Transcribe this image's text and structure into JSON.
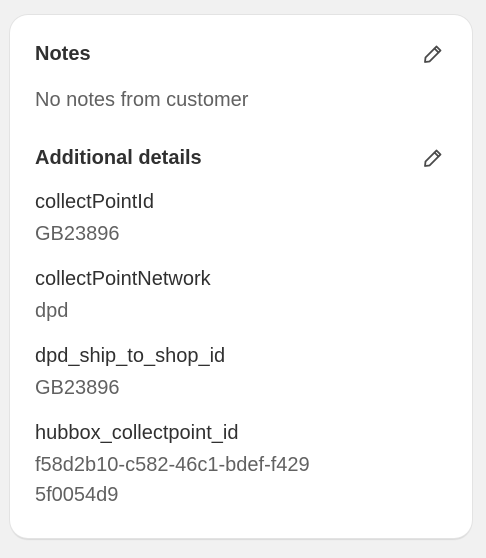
{
  "notes": {
    "title": "Notes",
    "edit_icon": "pencil-icon",
    "text": "No notes from customer"
  },
  "additional_details": {
    "title": "Additional details",
    "edit_icon": "pencil-icon",
    "items": [
      {
        "key": "collectPointId",
        "value": "GB23896"
      },
      {
        "key": "collectPointNetwork",
        "value": "dpd"
      },
      {
        "key": "dpd_ship_to_shop_id",
        "value": "GB23896"
      },
      {
        "key": "hubbox_collectpoint_id",
        "value": "f58d2b10-c582-46c1-bdef-f4295f0054d9"
      }
    ]
  },
  "colors": {
    "card_background": "#ffffff",
    "page_background": "#f1f1f1",
    "primary_text": "#303030",
    "secondary_text": "#616161"
  }
}
